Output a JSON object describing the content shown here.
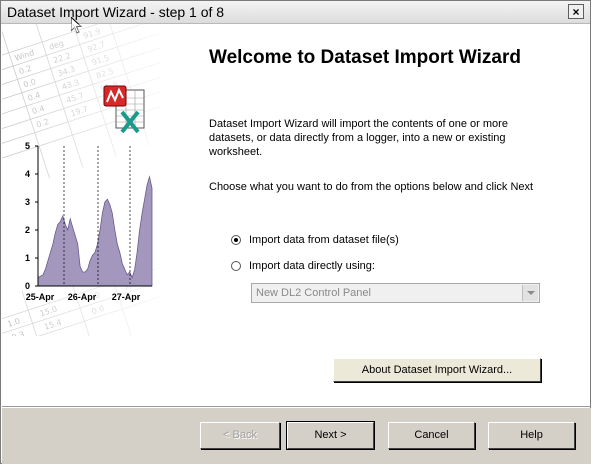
{
  "window": {
    "title": "Dataset Import Wizard - step 1 of 8",
    "close_label": "×"
  },
  "main": {
    "heading": "Welcome to Dataset Import Wizard",
    "description": "Dataset Import Wizard will import the contents of one or more datasets, or data directly from a logger, into a new or existing worksheet.",
    "instruction": "Choose what you want to do from the options below and click Next",
    "options": [
      {
        "label": "Import data from dataset file(s)",
        "selected": true
      },
      {
        "label": "Import data directly using:",
        "selected": false
      }
    ],
    "device_select_value": "New DL2 Control Panel",
    "about_button": "About Dataset Import Wizard..."
  },
  "footer": {
    "back": "< Back",
    "next": "Next >",
    "cancel": "Cancel",
    "help": "Help"
  },
  "illustration": {
    "y_ticks": [
      "0",
      "1",
      "2",
      "3",
      "4",
      "5"
    ],
    "x_ticks": [
      "25-Apr",
      "26-Apr",
      "27-Apr"
    ],
    "fill_color": "#9a8cb8"
  }
}
